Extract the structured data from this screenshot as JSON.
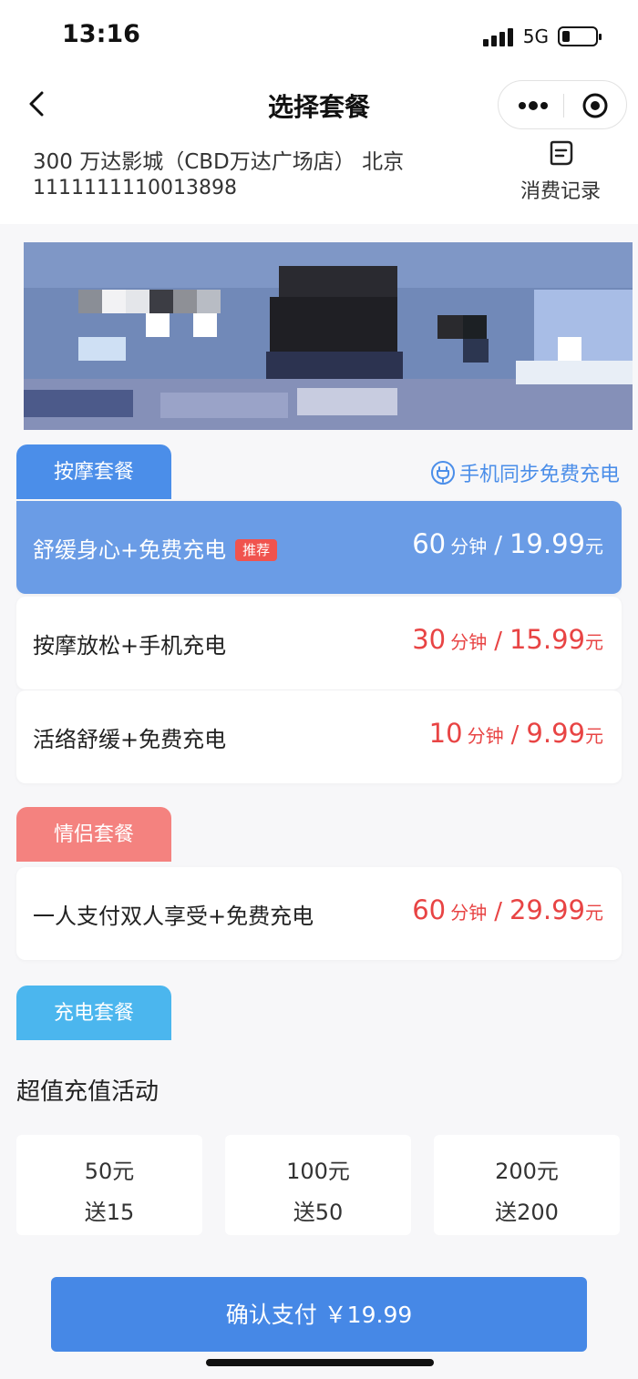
{
  "status_bar": {
    "time": "13:16",
    "network": "5G"
  },
  "nav": {
    "title": "选择套餐"
  },
  "store": {
    "name": "300 万达影城（CBD万达广场店） 北京",
    "id": "1111111110013898",
    "record_label": "消费记录"
  },
  "massage_section": {
    "tab_label": "按摩套餐",
    "sync_label": "手机同步免费充电",
    "packages": [
      {
        "name": "舒缓身心+免费充电",
        "badge": "推荐",
        "minutes": "60",
        "minute_unit": "分钟",
        "price": "19.99",
        "price_unit": "元",
        "selected": true
      },
      {
        "name": "按摩放松+手机充电",
        "minutes": "30",
        "minute_unit": "分钟",
        "price": "15.99",
        "price_unit": "元",
        "selected": false
      },
      {
        "name": "活络舒缓+免费充电",
        "minutes": "10",
        "minute_unit": "分钟",
        "price": "9.99",
        "price_unit": "元",
        "selected": false
      }
    ]
  },
  "couple_section": {
    "tab_label": "情侣套餐",
    "packages": [
      {
        "name": "一人支付双人享受+免费充电",
        "minutes": "60",
        "minute_unit": "分钟",
        "price": "29.99",
        "price_unit": "元",
        "selected": false
      }
    ]
  },
  "charge_section": {
    "tab_label": "充电套餐",
    "title": "超值充值活动",
    "options": [
      {
        "amount": "50元",
        "bonus": "送15"
      },
      {
        "amount": "100元",
        "bonus": "送50"
      },
      {
        "amount": "200元",
        "bonus": "送200"
      }
    ]
  },
  "pay": {
    "label": "确认支付 ￥19.99"
  },
  "colors": {
    "accent_blue": "#4b8ee9",
    "selected_card": "#6a9ce6",
    "price_red": "#e84444",
    "couple_pink": "#f4827f",
    "charge_cyan": "#4bb6ee",
    "badge_red": "#f0534e"
  }
}
